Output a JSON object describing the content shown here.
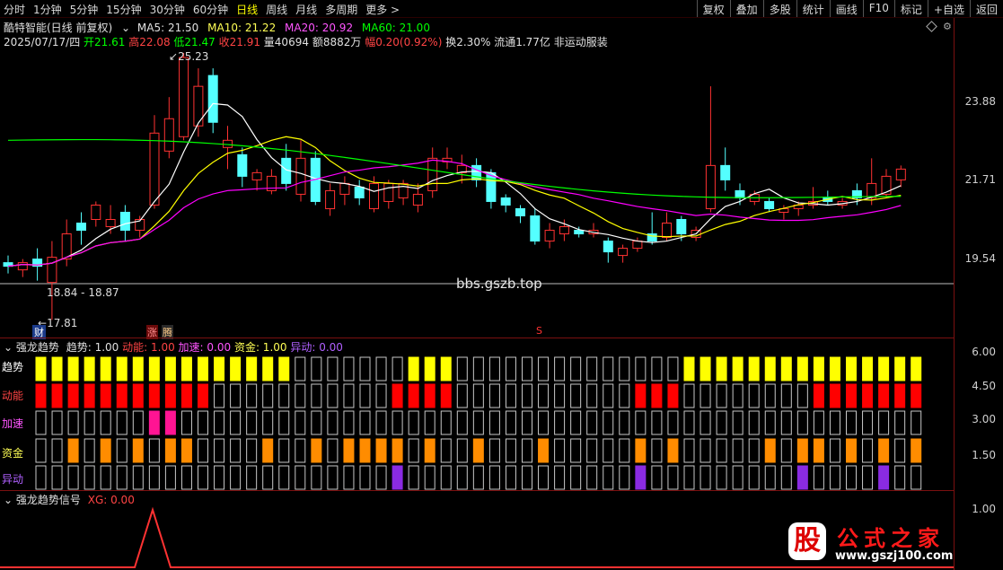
{
  "toolbar": {
    "periods": [
      "分时",
      "1分钟",
      "5分钟",
      "15分钟",
      "30分钟",
      "60分钟",
      "日线",
      "周线",
      "月线",
      "多周期",
      "更多 >"
    ],
    "active_period": "日线",
    "right_buttons": [
      "复权",
      "叠加",
      "多股",
      "统计",
      "画线",
      "F10",
      "标记",
      "+自选",
      "返回"
    ]
  },
  "stock": {
    "name": "酷特智能(日线 前复权)",
    "ma5_label": "MA5: 21.50",
    "ma10_label": "MA10: 21.22",
    "ma20_label": "MA20: 20.92",
    "ma60_label": "MA60: 21.00",
    "date": "2025/07/17/四",
    "open": "开21.61",
    "high": "高22.08",
    "low": "低21.47",
    "close": "收21.91",
    "volume": "量40694",
    "amount": "额8882万",
    "change": "幅0.20(0.92%)",
    "turnover": "换2.30%",
    "float": "流通1.77亿",
    "industry": "非运动服装"
  },
  "price_axis": [
    "23.88",
    "21.71",
    "19.54"
  ],
  "annotations": {
    "high_mark": "25.23",
    "low_mark": "17.81",
    "range": "18.84 - 18.87",
    "watermark_center": "bbs.gszb.top",
    "tag_cai": "财",
    "tag_zhang": "涨",
    "tag_teng": "腾",
    "tag_s": "S"
  },
  "indicator1": {
    "name": "强龙趋势",
    "trend": "趋势: 1.00",
    "momentum": "动能: 1.00",
    "accel": "加速: 0.00",
    "fund": "资金: 1.00",
    "abnormal": "异动: 0.00",
    "rows": [
      "趋势",
      "动能",
      "加速",
      "资金",
      "异动"
    ],
    "axis": [
      "6.00",
      "4.50",
      "3.00",
      "1.50"
    ]
  },
  "indicator2": {
    "name": "强龙趋势信号",
    "xg": "XG: 0.00",
    "axis": "1.00"
  },
  "logo": {
    "mark": "股",
    "title": "公式之家",
    "url": "www.gszj100.com"
  },
  "colors": {
    "up": "#ff3232",
    "down": "#54ffff",
    "ma5": "#ffffff",
    "ma10": "#ffff00",
    "ma20": "#ff00ff",
    "ma60": "#00ff00",
    "trend": "#ffff00",
    "momentum": "#ff0000",
    "accel": "#ff1493",
    "fund": "#ff8c00",
    "abnormal": "#8a2be2"
  }
}
